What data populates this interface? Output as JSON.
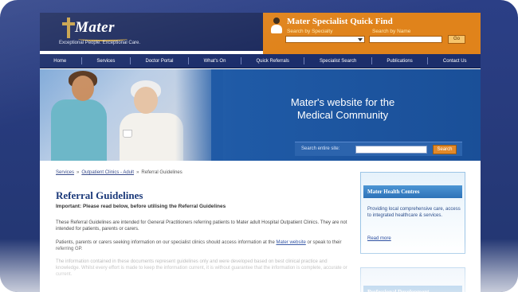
{
  "logo": {
    "name": "Mater",
    "tagline": "Exceptional People. Exceptional Care."
  },
  "quick_find": {
    "title": "Mater Specialist Quick Find",
    "specialty_label": "Search by Specialty",
    "name_label": "Search by Name",
    "specialty_value": "",
    "name_value": "",
    "go_label": "Go"
  },
  "nav": {
    "items": [
      "Home",
      "Services",
      "Doctor Portal",
      "What's On",
      "Quick Referrals",
      "Specialist Search",
      "Publications",
      "Contact Us"
    ]
  },
  "hero": {
    "line1": "Mater's website for the",
    "line2": "Medical Community",
    "search_label": "Search entire site:",
    "search_value": "",
    "search_button": "Search"
  },
  "breadcrumb": {
    "items": [
      "Services",
      "Outpatient Clinics - Adult"
    ],
    "current": "Referral Guidelines"
  },
  "content": {
    "title": "Referral Guidelines",
    "important": "Important: Please read below, before utilising the Referral Guidelines",
    "p1": "These Referral Guidelines are intended for General Practitioners referring patients to Mater adult Hospital Outpatient Clinics. They are not intended for patients, parents or carers.",
    "p2_before": "Patients, parents or carers seeking information on our specialist clinics should access information at the ",
    "p2_link": "Mater website",
    "p2_after": " or speak to their referring GP.",
    "p3": "The information contained in these documents represent guidelines only and were developed based on best clinical practice and knowledge. Whilst every effort is made to keep the information current, it is without guarantee that the information is complete, accurate or current."
  },
  "sidebar": {
    "box1_title": "Mater Health Centres",
    "box1_text": "Providing local comprehensive care, access to integrated healthcare & services.",
    "box1_link": "Read more",
    "box2_title": "Professional Development"
  },
  "colors": {
    "navy": "#1d2b5e",
    "orange": "#e0831b",
    "hero_blue": "#1f5aa6",
    "title_blue": "#1c3a7a"
  }
}
